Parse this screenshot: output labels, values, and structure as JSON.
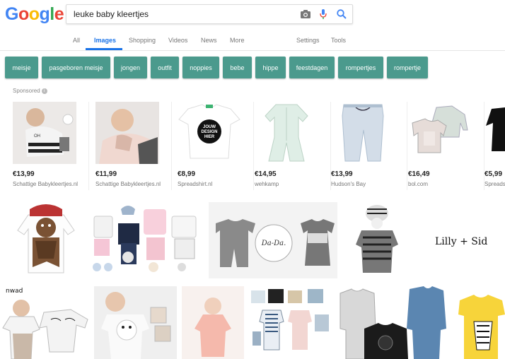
{
  "logo": {
    "letters": [
      "G",
      "o",
      "o",
      "g",
      "l",
      "e"
    ],
    "colors": [
      "#4285F4",
      "#EA4335",
      "#FBBC05",
      "#4285F4",
      "#34A853",
      "#EA4335"
    ]
  },
  "search": {
    "query": "leuke baby kleertjes"
  },
  "icons": {
    "camera": "camera-icon",
    "mic": "microphone-icon",
    "search": "search-icon"
  },
  "tabs": [
    "All",
    "Images",
    "Shopping",
    "Videos",
    "News",
    "More"
  ],
  "tabs_right": [
    "Settings",
    "Tools"
  ],
  "active_tab": "Images",
  "chips": [
    "meisje",
    "pasgeboren meisje",
    "jongen",
    "outfit",
    "noppies",
    "bebe",
    "hippe",
    "feestdagen",
    "rompertjes",
    "rompertje"
  ],
  "chip_color": "#4b9a8d",
  "sponsored_label": "Sponsored",
  "products": [
    {
      "price": "€13,99",
      "store": "Schattige Babykleertjes.nl"
    },
    {
      "price": "€11,99",
      "store": "Schattige Babykleertjes.nl"
    },
    {
      "price": "€8,99",
      "store": "Spreadshirt.nl"
    },
    {
      "price": "€14,95",
      "store": "wehkamp"
    },
    {
      "price": "€13,99",
      "store": "Hudson's Bay"
    },
    {
      "price": "€16,49",
      "store": "bol.com"
    },
    {
      "price": "€5,99",
      "store": "Spreads"
    }
  ],
  "image_texts": {
    "jouw_design_hier": [
      "JOUW",
      "DESIGN",
      "HIER"
    ],
    "dada": "Da-Da.",
    "lilly_sid": "Lilly + Sid",
    "nwad": "nwad"
  }
}
